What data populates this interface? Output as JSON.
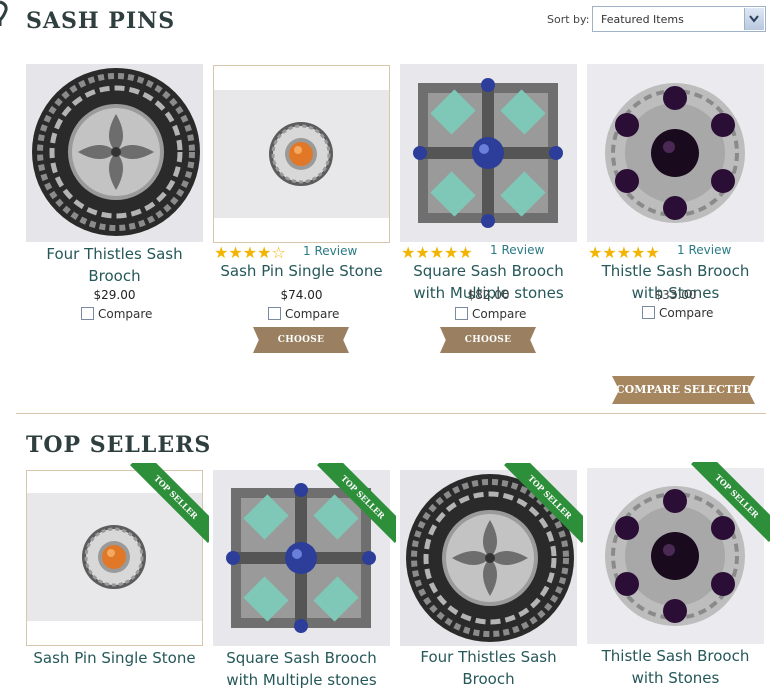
{
  "section_title": "SASH PINS",
  "sort": {
    "label": "Sort by:",
    "selected": "Featured Items"
  },
  "buttons": {
    "choose_options": "CHOOSE OPTIONS",
    "compare_selected": "COMPARE SELECTED"
  },
  "compare_label": "Compare",
  "products": [
    {
      "name_line1": "Four Thistles Sash",
      "name_line2": "Brooch",
      "price": "$29.00",
      "rating": 0,
      "reviews": ""
    },
    {
      "name_line1": "Sash Pin Single Stone",
      "name_line2": "",
      "price": "$74.00",
      "rating": 4,
      "reviews": "1 Review"
    },
    {
      "name_line1": "Square Sash Brooch",
      "name_line2": "with Multiple stones",
      "price": "$82.00",
      "rating": 5,
      "reviews": "1 Review"
    },
    {
      "name_line1": "Thistle Sash Brooch",
      "name_line2": "with Stones",
      "price": "$33.00",
      "rating": 5,
      "reviews": "1 Review"
    }
  ],
  "top_sellers": {
    "title": "TOP SELLERS",
    "ribbon_label": "TOP SELLER",
    "items": [
      {
        "name_line1": "Sash Pin Single Stone",
        "name_line2": ""
      },
      {
        "name_line1": "Square Sash Brooch",
        "name_line2": "with Multiple stones"
      },
      {
        "name_line1": "Four Thistles Sash",
        "name_line2": "Brooch"
      },
      {
        "name_line1": "Thistle Sash Brooch",
        "name_line2": "with Stones"
      }
    ]
  },
  "colors": {
    "heading": "#2f3e3e",
    "link": "#26585a",
    "button": "#9a8060",
    "ribbon": "#2e8f3a",
    "star": "#f2b400"
  }
}
